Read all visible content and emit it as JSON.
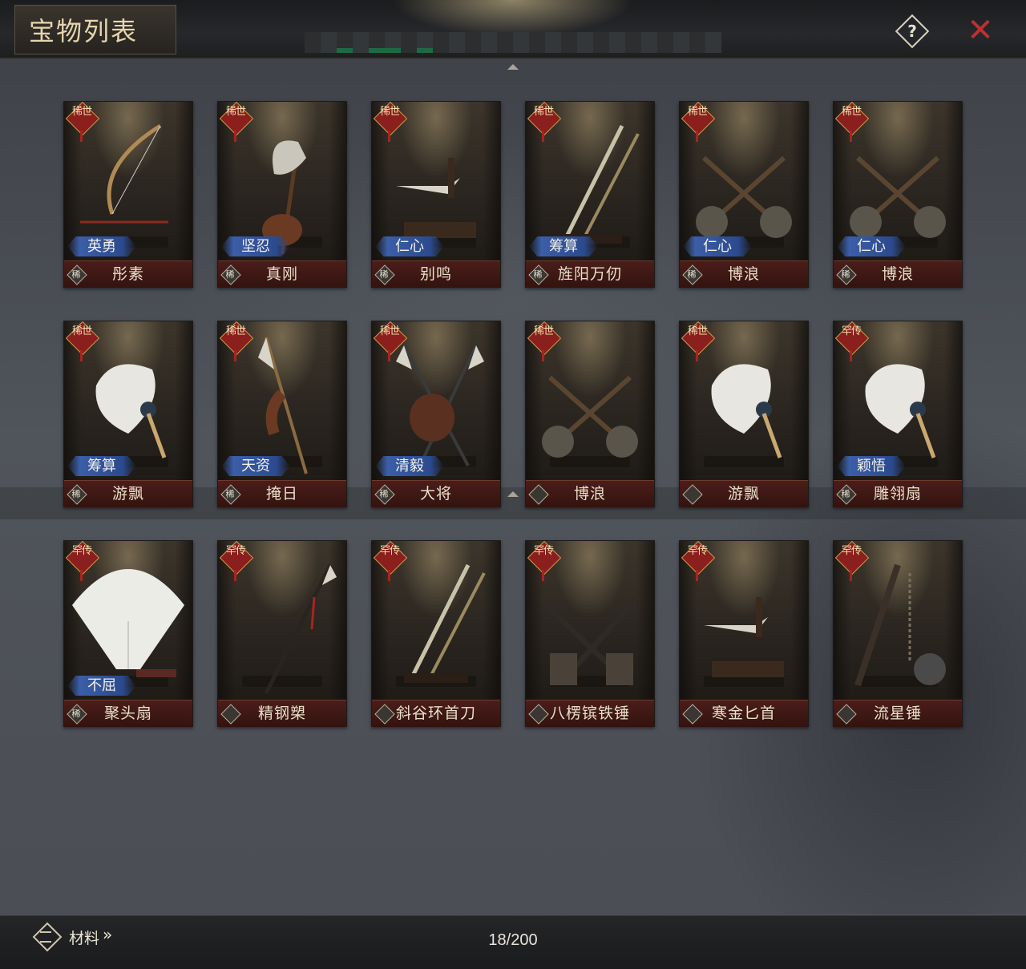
{
  "header": {
    "title": "宝物列表",
    "help_label": "?",
    "close_label": "✕"
  },
  "colors": {
    "name_bar": "#3f1814",
    "attribute_badge": "#3b5ea8",
    "rarity_tag": "#8a1f1d",
    "close": "#c03030"
  },
  "treasures": [
    {
      "rarity": "稀世",
      "attribute": "英勇",
      "name": "彤素",
      "emblem": "稀",
      "icon": "bow-icon"
    },
    {
      "rarity": "稀世",
      "attribute": "坚忍",
      "name": "真刚",
      "emblem": "稀",
      "icon": "axe-icon"
    },
    {
      "rarity": "稀世",
      "attribute": "仁心",
      "name": "别鸣",
      "emblem": "稀",
      "icon": "dagger-icon"
    },
    {
      "rarity": "稀世",
      "attribute": "筹算",
      "name": "旌阳万仞",
      "emblem": "稀",
      "icon": "sword-icon"
    },
    {
      "rarity": "稀世",
      "attribute": "仁心",
      "name": "博浪",
      "emblem": "稀",
      "icon": "mace-icon"
    },
    {
      "rarity": "稀世",
      "attribute": "仁心",
      "name": "博浪",
      "emblem": "稀",
      "icon": "mace-icon"
    },
    {
      "rarity": "稀世",
      "attribute": "筹算",
      "name": "游飘",
      "emblem": "稀",
      "icon": "feather-fan-icon"
    },
    {
      "rarity": "稀世",
      "attribute": "天资",
      "name": "掩日",
      "emblem": "稀",
      "icon": "halberd-icon"
    },
    {
      "rarity": "稀世",
      "attribute": "清毅",
      "name": "大将",
      "emblem": "稀",
      "icon": "crossed-halberds-icon"
    },
    {
      "rarity": "稀世",
      "attribute": "",
      "name": "博浪",
      "emblem": "",
      "icon": "mace-icon"
    },
    {
      "rarity": "稀世",
      "attribute": "",
      "name": "游飘",
      "emblem": "",
      "icon": "feather-fan-icon"
    },
    {
      "rarity": "罕传",
      "attribute": "颖悟",
      "name": "雕翎扇",
      "emblem": "稀",
      "icon": "feather-fan-icon"
    },
    {
      "rarity": "罕传",
      "attribute": "不屈",
      "name": "聚头扇",
      "emblem": "稀",
      "icon": "folding-fan-icon"
    },
    {
      "rarity": "罕传",
      "attribute": "",
      "name": "精钢槊",
      "emblem": "",
      "icon": "spear-icon"
    },
    {
      "rarity": "罕传",
      "attribute": "",
      "name": "斜谷环首刀",
      "emblem": "",
      "icon": "sword-icon"
    },
    {
      "rarity": "罕传",
      "attribute": "",
      "name": "八楞镔铁锤",
      "emblem": "",
      "icon": "hammer-icon"
    },
    {
      "rarity": "罕传",
      "attribute": "",
      "name": "寒金匕首",
      "emblem": "",
      "icon": "dagger-icon"
    },
    {
      "rarity": "罕传",
      "attribute": "",
      "name": "流星锤",
      "emblem": "",
      "icon": "meteor-hammer-icon"
    }
  ],
  "footer": {
    "materials_label": "材料",
    "materials_chevron": "»",
    "count_text": "18/200"
  }
}
